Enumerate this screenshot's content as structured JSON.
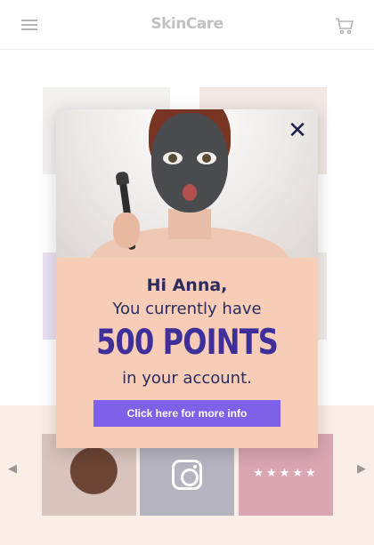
{
  "header": {
    "brand": "SkinCare",
    "menu_icon": "hamburger-menu-icon",
    "cart_icon": "shopping-cart-icon"
  },
  "popup": {
    "close_icon": "close-icon",
    "greeting": "Hi Anna,",
    "line2": "You currently have",
    "points": "500 POINTS",
    "line4": "in your account.",
    "cta_label": "Click here for more info",
    "image_subject": "woman-with-charcoal-face-mask"
  },
  "carousel": {
    "left_icon": "arrow-left-icon",
    "right_icon": "arrow-right-icon",
    "cards": [
      {
        "type": "photo",
        "icon": "smiling-woman-photo"
      },
      {
        "type": "social",
        "icon": "instagram-icon"
      },
      {
        "type": "rating",
        "stars": "★★★★★"
      }
    ]
  },
  "colors": {
    "popup_bg": "#f8cdb7",
    "primary_text": "#2b2c5e",
    "points_text": "#3e2f9a",
    "cta_bg": "#7d61e8",
    "strip_bg": "#fbeee6"
  }
}
